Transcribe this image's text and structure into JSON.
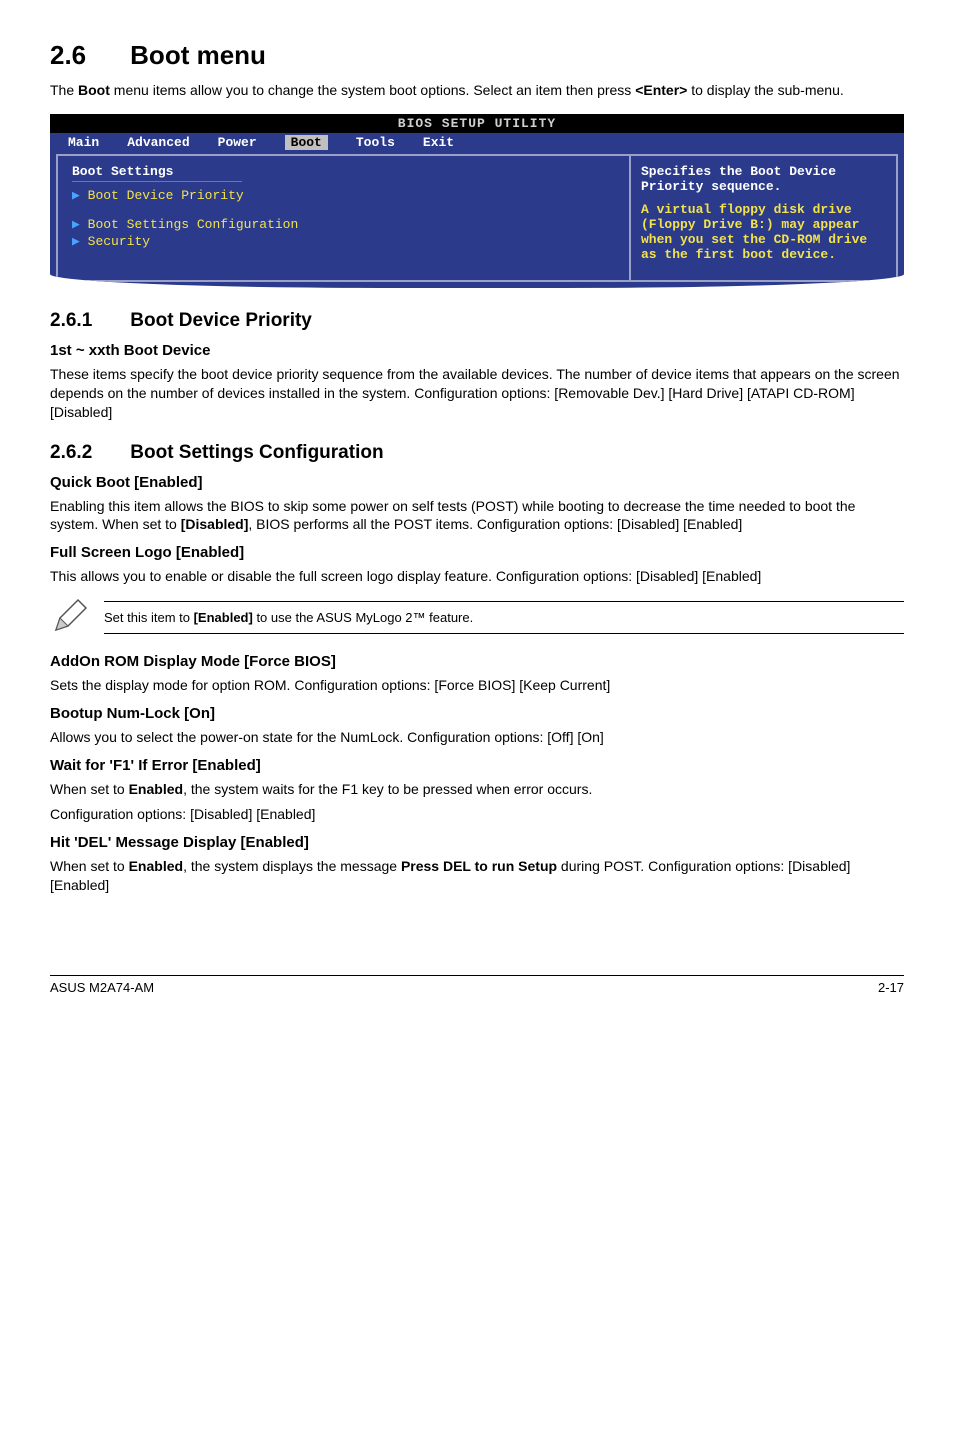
{
  "section": {
    "number": "2.6",
    "title": "Boot menu",
    "intro_1": "The ",
    "intro_bold": "Boot",
    "intro_2": " menu items allow you to change the system boot options. Select an item then press ",
    "intro_bold2": "<Enter>",
    "intro_3": " to display the sub-menu."
  },
  "bios": {
    "title": "BIOS SETUP UTILITY",
    "tabs": [
      "Main",
      "Advanced",
      "Power",
      "Boot",
      "Tools",
      "Exit"
    ],
    "heading": "Boot Settings",
    "items": [
      "Boot Device Priority",
      "Boot Settings Configuration",
      "Security"
    ],
    "help1": "Specifies the Boot Device Priority sequence.",
    "help2": "A virtual floppy disk drive (Floppy Drive B:) may appear when you set the CD-ROM drive as the first boot device."
  },
  "s261": {
    "number": "2.6.1",
    "title": "Boot Device Priority",
    "h3": "1st ~ xxth Boot Device",
    "p": "These items specify the boot device priority sequence from the available devices. The number of device items that appears on the screen depends on the number of devices installed in the system. Configuration options: [Removable Dev.] [Hard Drive] [ATAPI CD-ROM] [Disabled]"
  },
  "s262": {
    "number": "2.6.2",
    "title": "Boot Settings Configuration",
    "quick_h": "Quick Boot [Enabled]",
    "quick_p1": "Enabling this item allows the BIOS to skip some power on self tests (POST) while booting to decrease the time needed to boot the system. When set to ",
    "quick_bold": "[Disabled]",
    "quick_p2": ", BIOS performs all the POST items. Configuration options: [Disabled] [Enabled]",
    "logo_h": "Full Screen Logo [Enabled]",
    "logo_p": "This allows you to enable or disable the full screen logo display feature. Configuration options: [Disabled] [Enabled]",
    "note_1": "Set this item to ",
    "note_bold": "[Enabled]",
    "note_2": " to use the ASUS MyLogo 2™ feature.",
    "addon_h": "AddOn ROM Display Mode [Force BIOS]",
    "addon_p": "Sets the display mode for option ROM. Configuration options: [Force BIOS] [Keep Current]",
    "num_h": "Bootup Num-Lock [On]",
    "num_p": "Allows you to select the power-on state for the NumLock. Configuration options: [Off] [On]",
    "f1_h": "Wait for 'F1' If Error [Enabled]",
    "f1_p1a": "When set to ",
    "f1_bold": "Enabled",
    "f1_p1b": ", the system waits for the F1 key to be pressed when error occurs.",
    "f1_p2": "Configuration options: [Disabled] [Enabled]",
    "del_h": "Hit 'DEL' Message Display [Enabled]",
    "del_p1a": "When set to ",
    "del_bold1": "Enabled",
    "del_p1b": ", the system displays the message ",
    "del_bold2": "Press DEL to run Setup",
    "del_p1c": " during POST. Configuration options: [Disabled] [Enabled]"
  },
  "footer": {
    "left": "ASUS M2A74-AM",
    "right": "2-17"
  }
}
